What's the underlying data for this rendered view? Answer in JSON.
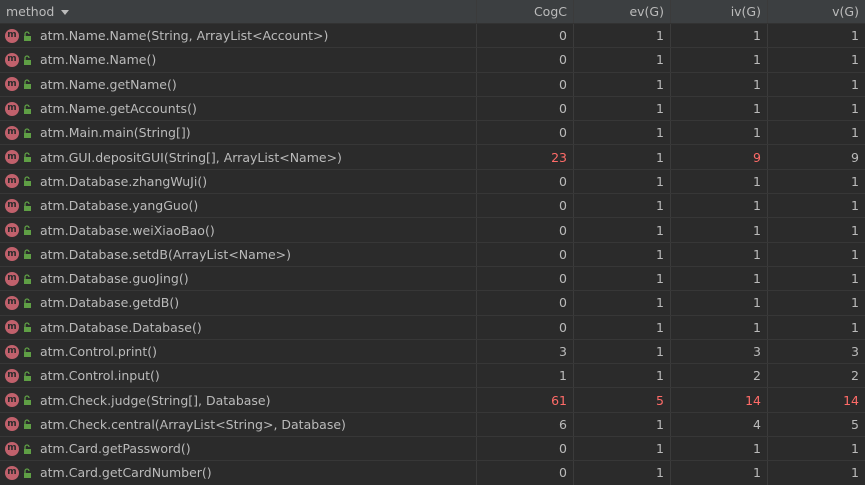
{
  "header": {
    "method": "method",
    "cogc": "CogC",
    "ev": "ev(G)",
    "iv": "iv(G)",
    "v": "v(G)"
  },
  "icons": {
    "method_badge": "m",
    "method_icon": "method-icon",
    "visibility_icon": "unlocked-icon"
  },
  "colors": {
    "highlight": "#ff6b68",
    "method_badge": "#c1616c",
    "visibility": "#5f9f45"
  },
  "rows": [
    {
      "method": "atm.Name.Name(String, ArrayList<Account>)",
      "cogc": "0",
      "ev": "1",
      "iv": "1",
      "v": "1",
      "red": []
    },
    {
      "method": "atm.Name.Name()",
      "cogc": "0",
      "ev": "1",
      "iv": "1",
      "v": "1",
      "red": []
    },
    {
      "method": "atm.Name.getName()",
      "cogc": "0",
      "ev": "1",
      "iv": "1",
      "v": "1",
      "red": []
    },
    {
      "method": "atm.Name.getAccounts()",
      "cogc": "0",
      "ev": "1",
      "iv": "1",
      "v": "1",
      "red": []
    },
    {
      "method": "atm.Main.main(String[])",
      "cogc": "0",
      "ev": "1",
      "iv": "1",
      "v": "1",
      "red": []
    },
    {
      "method": "atm.GUI.depositGUI(String[], ArrayList<Name>)",
      "cogc": "23",
      "ev": "1",
      "iv": "9",
      "v": "9",
      "red": [
        "cogc",
        "iv"
      ]
    },
    {
      "method": "atm.Database.zhangWuJi()",
      "cogc": "0",
      "ev": "1",
      "iv": "1",
      "v": "1",
      "red": []
    },
    {
      "method": "atm.Database.yangGuo()",
      "cogc": "0",
      "ev": "1",
      "iv": "1",
      "v": "1",
      "red": []
    },
    {
      "method": "atm.Database.weiXiaoBao()",
      "cogc": "0",
      "ev": "1",
      "iv": "1",
      "v": "1",
      "red": []
    },
    {
      "method": "atm.Database.setdB(ArrayList<Name>)",
      "cogc": "0",
      "ev": "1",
      "iv": "1",
      "v": "1",
      "red": []
    },
    {
      "method": "atm.Database.guoJing()",
      "cogc": "0",
      "ev": "1",
      "iv": "1",
      "v": "1",
      "red": []
    },
    {
      "method": "atm.Database.getdB()",
      "cogc": "0",
      "ev": "1",
      "iv": "1",
      "v": "1",
      "red": []
    },
    {
      "method": "atm.Database.Database()",
      "cogc": "0",
      "ev": "1",
      "iv": "1",
      "v": "1",
      "red": []
    },
    {
      "method": "atm.Control.print()",
      "cogc": "3",
      "ev": "1",
      "iv": "3",
      "v": "3",
      "red": []
    },
    {
      "method": "atm.Control.input()",
      "cogc": "1",
      "ev": "1",
      "iv": "2",
      "v": "2",
      "red": []
    },
    {
      "method": "atm.Check.judge(String[], Database)",
      "cogc": "61",
      "ev": "5",
      "iv": "14",
      "v": "14",
      "red": [
        "cogc",
        "ev",
        "iv",
        "v"
      ]
    },
    {
      "method": "atm.Check.central(ArrayList<String>, Database)",
      "cogc": "6",
      "ev": "1",
      "iv": "4",
      "v": "5",
      "red": []
    },
    {
      "method": "atm.Card.getPassword()",
      "cogc": "0",
      "ev": "1",
      "iv": "1",
      "v": "1",
      "red": []
    },
    {
      "method": "atm.Card.getCardNumber()",
      "cogc": "0",
      "ev": "1",
      "iv": "1",
      "v": "1",
      "red": []
    }
  ]
}
